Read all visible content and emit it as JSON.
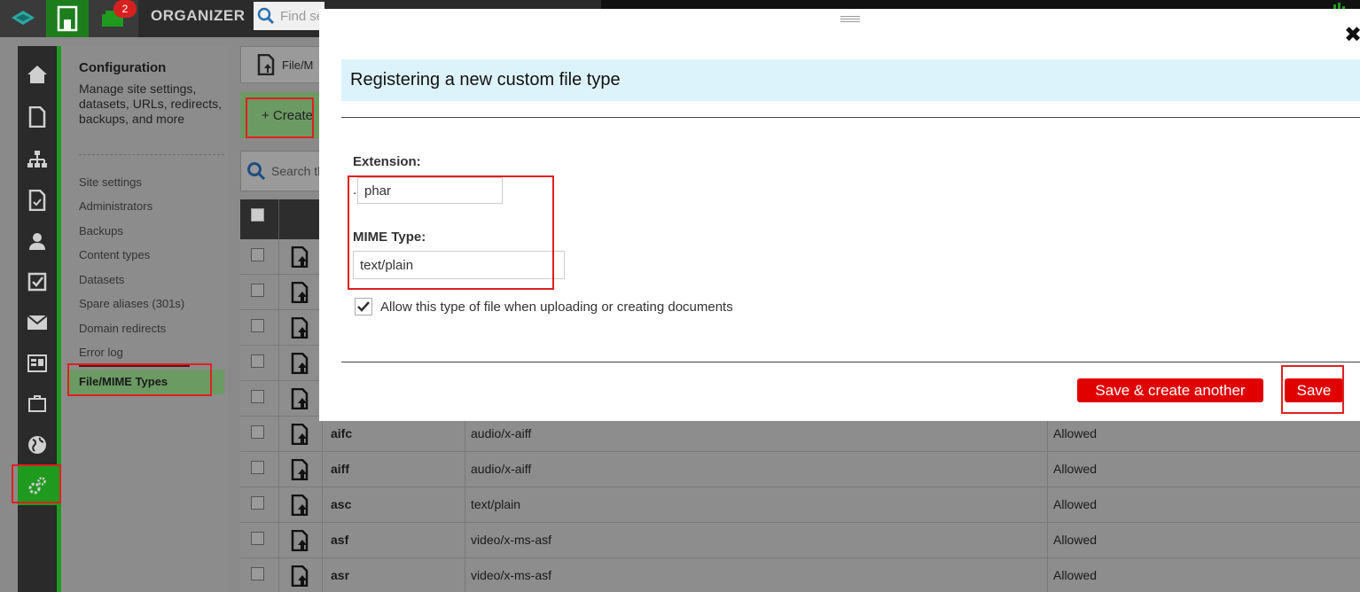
{
  "topbar": {
    "app_title": "ORGANIZER",
    "search_placeholder": "Find se",
    "inbox_badge": "2"
  },
  "config": {
    "title": "Configuration",
    "description": "Manage site settings, datasets, URLs, redirects, backups, and more",
    "menu": [
      {
        "label": "Site settings"
      },
      {
        "label": "Administrators"
      },
      {
        "label": "Backups"
      },
      {
        "label": "Content types"
      },
      {
        "label": "Datasets"
      },
      {
        "label": "Spare aliases (301s)"
      },
      {
        "label": "Domain redirects"
      },
      {
        "label": "Error log"
      },
      {
        "label": "File/MIME Types",
        "active": true
      }
    ]
  },
  "main": {
    "breadcrumb": "File/M",
    "create_label": "+ Create",
    "search_placeholder": "Search th",
    "rows": [
      {
        "ext": "",
        "mime": "",
        "status": ""
      },
      {
        "ext": "",
        "mime": "",
        "status": ""
      },
      {
        "ext": "",
        "mime": "",
        "status": ""
      },
      {
        "ext": "",
        "mime": "",
        "status": ""
      },
      {
        "ext": "",
        "mime": "",
        "status": ""
      },
      {
        "ext": "aifc",
        "mime": "audio/x-aiff",
        "status": "Allowed"
      },
      {
        "ext": "aiff",
        "mime": "audio/x-aiff",
        "status": "Allowed"
      },
      {
        "ext": "asc",
        "mime": "text/plain",
        "status": "Allowed"
      },
      {
        "ext": "asf",
        "mime": "video/x-ms-asf",
        "status": "Allowed"
      },
      {
        "ext": "asr",
        "mime": "video/x-ms-asf",
        "status": "Allowed"
      }
    ]
  },
  "modal": {
    "title": "Registering a new custom file type",
    "extension_label": "Extension:",
    "extension_prefix": ".",
    "extension_value": "phar",
    "mime_label": "MIME Type:",
    "mime_value": "text/plain",
    "allow_label": "Allow this type of file when uploading or creating documents",
    "allow_checked": true,
    "save_another_label": "Save & create another",
    "save_label": "Save",
    "close_glyph": "✖"
  },
  "colors": {
    "accent_green": "#1f9a1f",
    "save_red": "#e00000",
    "highlight_red": "#e02020",
    "title_bar": "#ddf3fb"
  }
}
